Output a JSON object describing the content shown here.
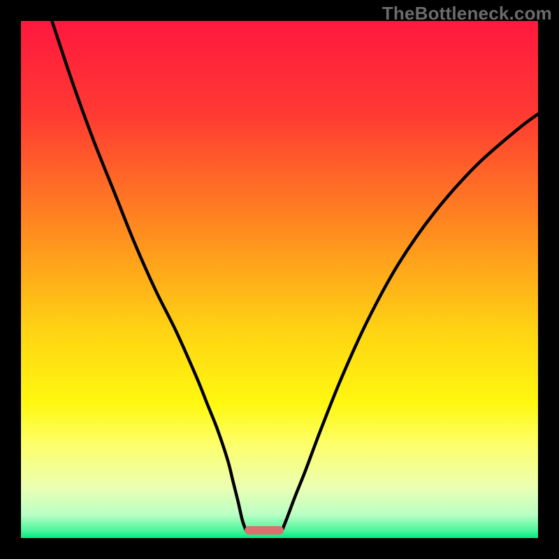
{
  "watermark": {
    "text": "TheBottleneck.com"
  },
  "chart_data": {
    "type": "line",
    "title": "",
    "xlabel": "",
    "ylabel": "",
    "xlim": [
      0,
      100
    ],
    "ylim": [
      0,
      100
    ],
    "grid": false,
    "legend": false,
    "background_gradient_stops": [
      {
        "offset": 0.0,
        "color": "#ff183f"
      },
      {
        "offset": 0.18,
        "color": "#ff3a32"
      },
      {
        "offset": 0.4,
        "color": "#ff8a1f"
      },
      {
        "offset": 0.6,
        "color": "#ffd413"
      },
      {
        "offset": 0.74,
        "color": "#fff810"
      },
      {
        "offset": 0.82,
        "color": "#fdff6b"
      },
      {
        "offset": 0.9,
        "color": "#ecffb1"
      },
      {
        "offset": 0.955,
        "color": "#baffc5"
      },
      {
        "offset": 0.985,
        "color": "#4ef59d"
      },
      {
        "offset": 1.0,
        "color": "#00eb82"
      }
    ],
    "series": [
      {
        "name": "left-curve",
        "x": [
          6,
          10,
          14,
          18,
          22,
          26,
          30,
          34,
          36,
          38,
          40,
          41,
          42,
          42.8,
          43.5
        ],
        "y": [
          100,
          88,
          77,
          67,
          57,
          48,
          40,
          31,
          26,
          21,
          15,
          11,
          7,
          3.5,
          1.5
        ]
      },
      {
        "name": "right-curve",
        "x": [
          50.5,
          51.5,
          53,
          55,
          58,
          62,
          67,
          73,
          80,
          88,
          96,
          100
        ],
        "y": [
          1.5,
          4,
          8,
          13,
          21,
          31,
          42,
          53,
          63,
          72,
          79,
          82
        ]
      }
    ],
    "marker": {
      "x_center": 47,
      "y": 1.5,
      "width_pct": 7.5,
      "height_pct": 1.6,
      "color": "#d9706d"
    }
  }
}
